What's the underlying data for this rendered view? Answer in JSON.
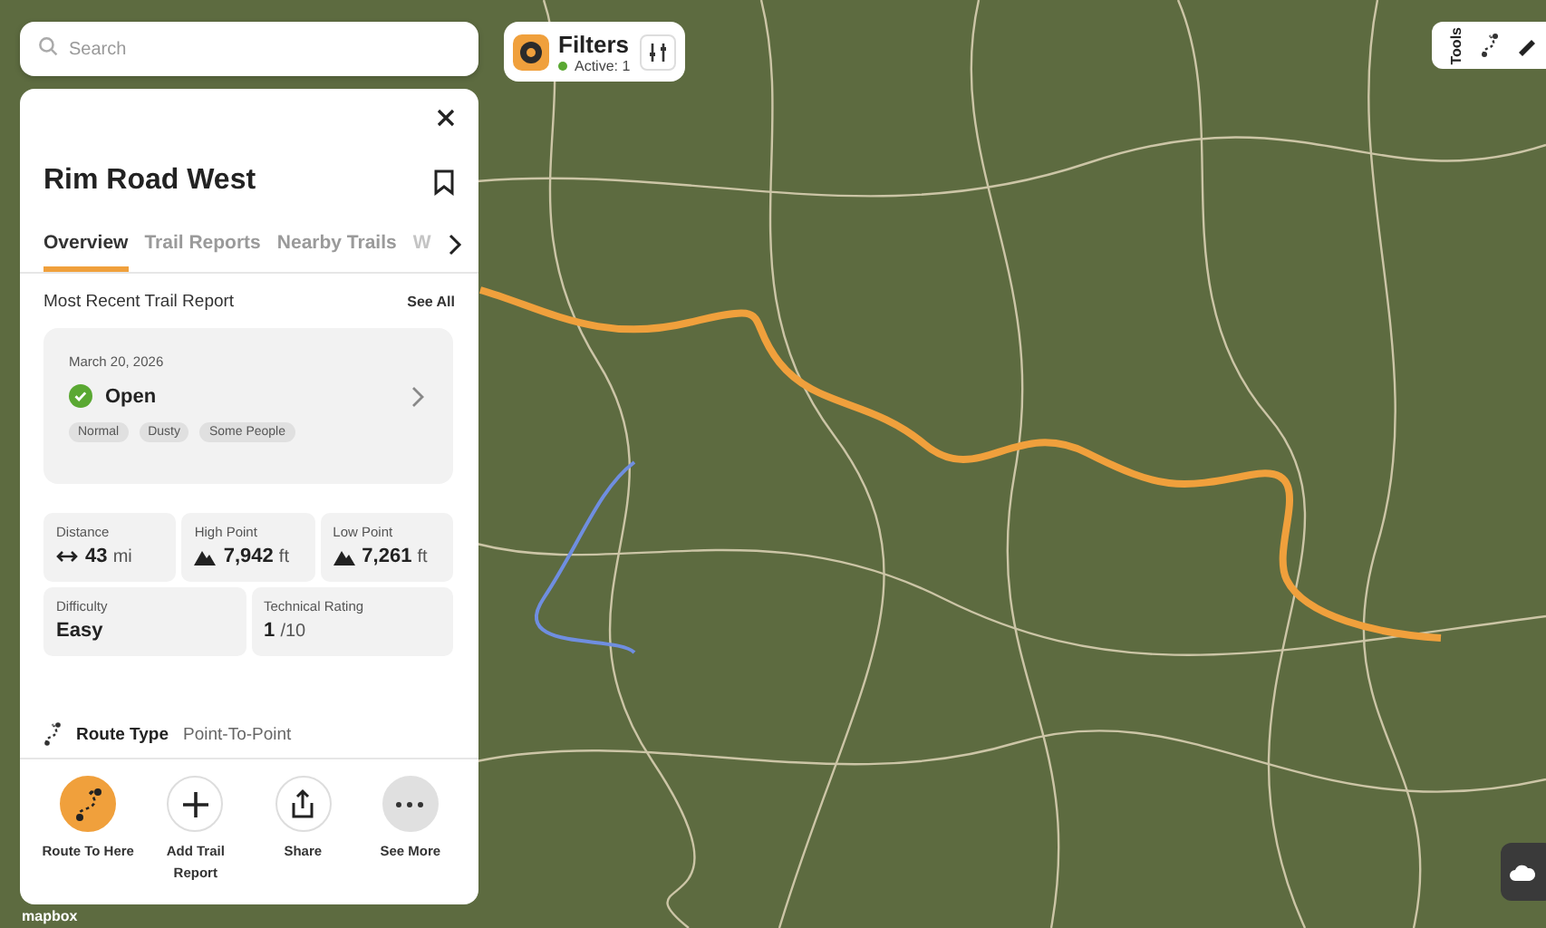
{
  "search": {
    "placeholder": "Search"
  },
  "filters": {
    "title": "Filters",
    "active": "Active: 1"
  },
  "tools": {
    "label": "Tools"
  },
  "panel": {
    "title": "Rim Road West",
    "tabs": [
      {
        "label": "Overview",
        "selected": true
      },
      {
        "label": "Trail Reports",
        "selected": false
      },
      {
        "label": "Nearby Trails",
        "selected": false
      },
      {
        "label": "W",
        "selected": false
      }
    ],
    "report_heading": "Most Recent Trail Report",
    "see_all": "See All",
    "report": {
      "date": "March 20, 2026",
      "status": "Open",
      "tags": [
        "Normal",
        "Dusty",
        "Some People"
      ]
    },
    "stats": [
      {
        "label": "Distance",
        "kind": "distance",
        "value": "43",
        "unit": "mi"
      },
      {
        "label": "High Point",
        "kind": "elevation",
        "value": "7,942",
        "unit": "ft"
      },
      {
        "label": "Low Point",
        "kind": "elevation",
        "value": "7,261",
        "unit": "ft"
      },
      {
        "label": "Difficulty",
        "kind": "plain",
        "value": "Easy"
      },
      {
        "label": "Technical Rating",
        "kind": "plain",
        "value": "1",
        "unit": "/10"
      }
    ],
    "route_type": {
      "label": "Route Type",
      "value": "Point-To-Point"
    },
    "actions": [
      {
        "label": "Route To Here",
        "kind": "route"
      },
      {
        "label": "Add Trail Report",
        "kind": "add"
      },
      {
        "label": "Share",
        "kind": "share"
      },
      {
        "label": "See More",
        "kind": "more"
      }
    ]
  },
  "attribution": "mapbox"
}
